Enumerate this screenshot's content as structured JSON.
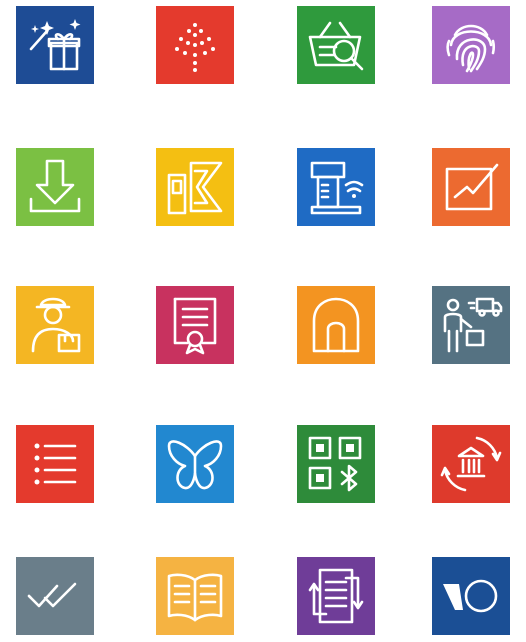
{
  "tiles": [
    {
      "icon": "magic-gift-icon",
      "color": "#1e4c95"
    },
    {
      "icon": "sparkle-tree-icon",
      "color": "#e43a2d"
    },
    {
      "icon": "basket-search-icon",
      "color": "#2f9a3d"
    },
    {
      "icon": "fingerprint-icon",
      "color": "#a66bc6"
    },
    {
      "icon": "download-icon",
      "color": "#7bc043"
    },
    {
      "icon": "cash-card-icon",
      "color": "#f4bf12"
    },
    {
      "icon": "nfc-terminal-icon",
      "color": "#1f6bc4"
    },
    {
      "icon": "checkbox-chart-icon",
      "color": "#ec6a30"
    },
    {
      "icon": "delivery-person-icon",
      "color": "#f4b623"
    },
    {
      "icon": "certificate-icon",
      "color": "#c8325f"
    },
    {
      "icon": "arch-door-icon",
      "color": "#f39421"
    },
    {
      "icon": "courier-truck-icon",
      "color": "#557282"
    },
    {
      "icon": "list-icon",
      "color": "#e43a2d"
    },
    {
      "icon": "butterfly-icon",
      "color": "#2288d0"
    },
    {
      "icon": "qr-bluetooth-icon",
      "color": "#2e8b3a"
    },
    {
      "icon": "bank-transfer-icon",
      "color": "#de3a2c"
    },
    {
      "icon": "double-check-icon",
      "color": "#6a7e8a"
    },
    {
      "icon": "open-book-icon",
      "color": "#f5b342"
    },
    {
      "icon": "document-sync-icon",
      "color": "#6f3d98"
    },
    {
      "icon": "io-logo-icon",
      "color": "#1b4f95"
    }
  ]
}
